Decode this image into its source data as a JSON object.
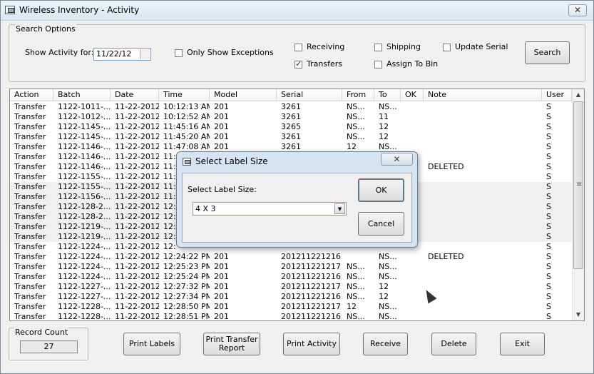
{
  "window": {
    "title": "Wireless Inventory - Activity",
    "close_label": "✕"
  },
  "search_options": {
    "legend": "Search Options",
    "show_activity_label": "Show Activity for:",
    "date_value": "11/22/12",
    "only_exceptions_label": "Only Show Exceptions",
    "only_exceptions_checked": false,
    "receiving_label": "Receiving",
    "receiving_checked": false,
    "transfers_label": "Transfers",
    "transfers_checked": true,
    "shipping_label": "Shipping",
    "shipping_checked": false,
    "assign_to_bin_label": "Assign To Bin",
    "assign_to_bin_checked": false,
    "update_serial_label": "Update Serial",
    "update_serial_checked": false,
    "search_button": "Search"
  },
  "grid": {
    "columns": [
      "Action",
      "Batch",
      "Date",
      "Time",
      "Model",
      "Serial",
      "From",
      "To",
      "OK",
      "Note",
      "User"
    ],
    "rows": [
      [
        "Transfer",
        "1122-1011-...",
        "11-22-2012",
        "10:12:13 AM",
        "201",
        "3261",
        "NS...",
        "NS...",
        "",
        "",
        "S"
      ],
      [
        "Transfer",
        "1122-1012-...",
        "11-22-2012",
        "10:12:52 AM",
        "201",
        "3261",
        "NS...",
        "11",
        "",
        "",
        "S"
      ],
      [
        "Transfer",
        "1122-1145-...",
        "11-22-2012",
        "11:45:16 AM",
        "201",
        "3265",
        "NS...",
        "12",
        "",
        "",
        "S"
      ],
      [
        "Transfer",
        "1122-1145-...",
        "11-22-2012",
        "11:45:20 AM",
        "201",
        "3261",
        "NS...",
        "12",
        "",
        "",
        "S"
      ],
      [
        "Transfer",
        "1122-1146-...",
        "11-22-2012",
        "11:47:08 AM",
        "201",
        "3261",
        "12",
        "NS...",
        "",
        "",
        "S"
      ],
      [
        "Transfer",
        "1122-1146-...",
        "11-22-2012",
        "11:",
        "",
        "",
        "",
        "",
        "",
        "",
        "S"
      ],
      [
        "Transfer",
        "1122-1146-...",
        "11-22-2012",
        "11:",
        "",
        "",
        "",
        "",
        "",
        "DELETED",
        "S"
      ],
      [
        "Transfer",
        "1122-1155-...",
        "11-22-2012",
        "11:",
        "",
        "",
        "",
        "",
        "",
        "",
        "S"
      ],
      [
        "Transfer",
        "1122-1155-...",
        "11-22-2012",
        "11:",
        "",
        "",
        "",
        "",
        "",
        "",
        "S"
      ],
      [
        "Transfer",
        "1122-1156-...",
        "11-22-2012",
        "11:",
        "",
        "",
        "",
        "",
        "",
        "",
        "S"
      ],
      [
        "Transfer",
        "1122-128-2...",
        "11-22-2012",
        "12:",
        "",
        "",
        "",
        "",
        "",
        "",
        "S"
      ],
      [
        "Transfer",
        "1122-128-2...",
        "11-22-2012",
        "12:",
        "",
        "",
        "",
        "",
        "",
        "",
        "S"
      ],
      [
        "Transfer",
        "1122-1219-...",
        "11-22-2012",
        "12:",
        "",
        "",
        "",
        "",
        "",
        "",
        "S"
      ],
      [
        "Transfer",
        "1122-1219-...",
        "11-22-2012",
        "12:",
        "",
        "",
        "",
        "",
        "",
        "",
        "S"
      ],
      [
        "Transfer",
        "1122-1224-...",
        "11-22-2012",
        "12:",
        "",
        "",
        "",
        "",
        "",
        "",
        "S"
      ],
      [
        "Transfer",
        "1122-1224-...",
        "11-22-2012",
        "12:24:22 PM",
        "201",
        "201211221216",
        "",
        "NS...",
        "",
        "DELETED",
        "S"
      ],
      [
        "Transfer",
        "1122-1224-...",
        "11-22-2012",
        "12:25:23 PM",
        "201",
        "201211221217",
        "NS...",
        "NS...",
        "",
        "",
        "S"
      ],
      [
        "Transfer",
        "1122-1224-...",
        "11-22-2012",
        "12:25:24 PM",
        "201",
        "201211221216",
        "NS...",
        "NS...",
        "",
        "",
        "S"
      ],
      [
        "Transfer",
        "1122-1227-...",
        "11-22-2012",
        "12:27:32 PM",
        "201",
        "201211221217",
        "NS...",
        "12",
        "",
        "",
        "S"
      ],
      [
        "Transfer",
        "1122-1227-...",
        "11-22-2012",
        "12:27:34 PM",
        "201",
        "201211221216",
        "NS...",
        "12",
        "",
        "",
        "S"
      ],
      [
        "Transfer",
        "1122-1228-...",
        "11-22-2012",
        "12:28:50 PM",
        "201",
        "201211221217",
        "12",
        "NS...",
        "",
        "",
        "S"
      ],
      [
        "Transfer",
        "1122-1228-...",
        "11-22-2012",
        "12:28:51 PM",
        "201",
        "201211221216",
        "NS...",
        "NS...",
        "",
        "",
        "S"
      ]
    ]
  },
  "record_count": {
    "legend": "Record Count",
    "value": "27"
  },
  "buttons": {
    "print_labels": "Print Labels",
    "print_transfer_report": "Print Transfer Report",
    "print_activity": "Print Activity",
    "receive": "Receive",
    "delete": "Delete",
    "exit": "Exit"
  },
  "dialog": {
    "title": "Select Label Size",
    "close_label": "✕",
    "prompt": "Select Label Size:",
    "selected_size": "4 X 3",
    "ok_button": "OK",
    "cancel_button": "Cancel"
  }
}
